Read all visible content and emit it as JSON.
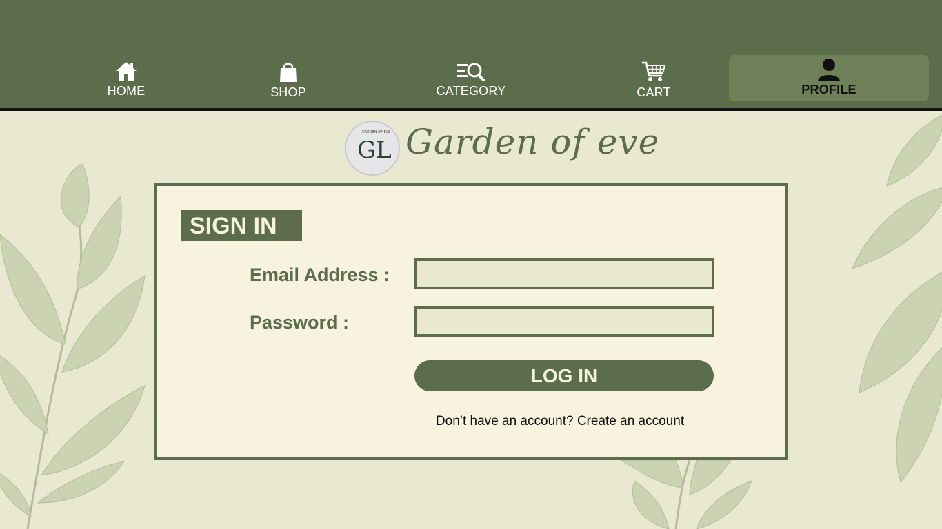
{
  "nav": {
    "home_label": "HOME",
    "shop_label": "SHOP",
    "category_label": "CATEGORY",
    "cart_label": "CART",
    "profile_label": "PROFILE"
  },
  "brand": {
    "name": "Garden of eve",
    "logo_letters": "GL",
    "logo_ring_text": "GARDEN OF EVE"
  },
  "signin": {
    "title": "SIGN IN",
    "email_label": "Email Address :",
    "email_value": "",
    "password_label": "Password :",
    "password_value": "",
    "login_label": "LOG IN",
    "no_account_text": "Don’t have an account?",
    "create_account_link": "Create an account"
  },
  "icons": {
    "home": "home-icon",
    "shop": "shopping-bag-icon",
    "category": "category-search-icon",
    "cart": "cart-icon",
    "profile": "user-icon"
  },
  "colors": {
    "primary_green": "#5b6d4b",
    "active_tab": "#6e8158",
    "page_bg": "#e8e9d0",
    "card_bg": "#f8f3de"
  }
}
